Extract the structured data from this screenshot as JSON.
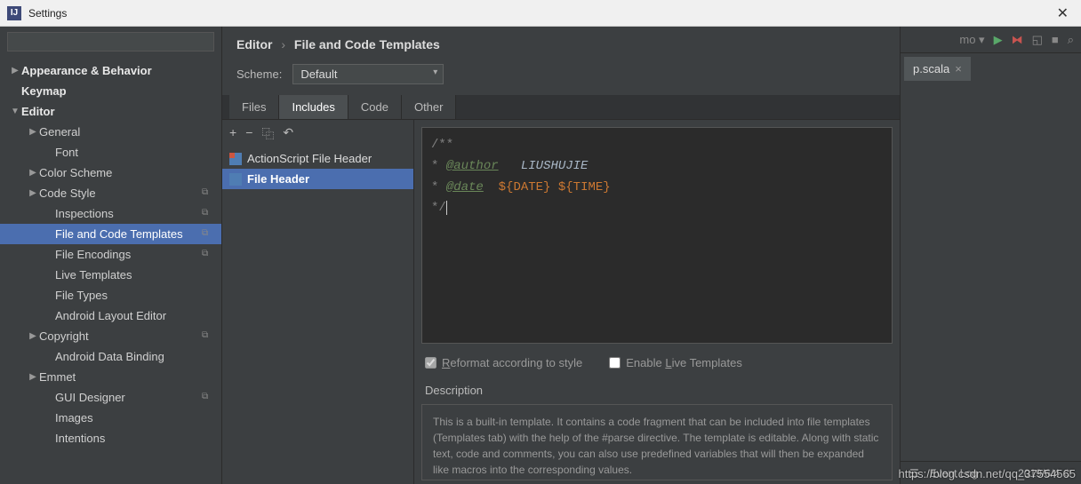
{
  "window": {
    "title": "Settings"
  },
  "search": {
    "placeholder": ""
  },
  "tree": [
    {
      "label": "Appearance & Behavior",
      "indent": 0,
      "caret": "▶",
      "bold": true
    },
    {
      "label": "Keymap",
      "indent": 0,
      "caret": "",
      "bold": true
    },
    {
      "label": "Editor",
      "indent": 0,
      "caret": "▼",
      "bold": true
    },
    {
      "label": "General",
      "indent": 1,
      "caret": "▶"
    },
    {
      "label": "Font",
      "indent": 2,
      "caret": ""
    },
    {
      "label": "Color Scheme",
      "indent": 1,
      "caret": "▶"
    },
    {
      "label": "Code Style",
      "indent": 1,
      "caret": "▶",
      "badge": "⧉"
    },
    {
      "label": "Inspections",
      "indent": 2,
      "caret": "",
      "badge": "⧉"
    },
    {
      "label": "File and Code Templates",
      "indent": 2,
      "caret": "",
      "badge": "⧉",
      "selected": true
    },
    {
      "label": "File Encodings",
      "indent": 2,
      "caret": "",
      "badge": "⧉"
    },
    {
      "label": "Live Templates",
      "indent": 2,
      "caret": ""
    },
    {
      "label": "File Types",
      "indent": 2,
      "caret": ""
    },
    {
      "label": "Android Layout Editor",
      "indent": 2,
      "caret": ""
    },
    {
      "label": "Copyright",
      "indent": 1,
      "caret": "▶",
      "badge": "⧉"
    },
    {
      "label": "Android Data Binding",
      "indent": 2,
      "caret": ""
    },
    {
      "label": "Emmet",
      "indent": 1,
      "caret": "▶"
    },
    {
      "label": "GUI Designer",
      "indent": 2,
      "caret": "",
      "badge": "⧉"
    },
    {
      "label": "Images",
      "indent": 2,
      "caret": ""
    },
    {
      "label": "Intentions",
      "indent": 2,
      "caret": ""
    }
  ],
  "breadcrumb": {
    "a": "Editor",
    "b": "File and Code Templates"
  },
  "scheme": {
    "label": "Scheme:",
    "value": "Default"
  },
  "tabs": [
    "Files",
    "Includes",
    "Code",
    "Other"
  ],
  "active_tab": 1,
  "toolbar": {
    "add": "+",
    "remove": "−",
    "copy": "⿻",
    "revert": "↶"
  },
  "templates": [
    {
      "name": "ActionScript File Header",
      "selected": false,
      "icon": "as"
    },
    {
      "name": "File Header",
      "selected": true,
      "icon": "fh"
    }
  ],
  "editor": {
    "line1_open": "/**",
    "line2_star": "* ",
    "line2_tag": "@author",
    "line2_spaces": "   ",
    "line2_ident": "LIUSHUJIE",
    "line3_star": "* ",
    "line3_tag": "@date",
    "line3_sp": "  ",
    "line3_var1": "${DATE}",
    "line3_sp2": " ",
    "line3_var2": "${TIME}",
    "line4_close": "*/"
  },
  "checks": {
    "reformat_pre": "R",
    "reformat": "eformat according to style",
    "live_pre": "Enable ",
    "live_u": "L",
    "live_post": "ive Templates"
  },
  "description": {
    "label": "Description",
    "text": "This is a built-in template. It contains a code fragment that can be included into file templates (Templates tab) with the help of the #parse directive.\nThe template is editable. Along with static text, code and comments, you can also use predefined variables that will then be expanded like macros into the corresponding values."
  },
  "right": {
    "combo_suffix": "mo ▾",
    "file_tab": "p.scala",
    "event_log": "Event Log",
    "date": "2019/6/4"
  },
  "watermark": "https://blog.csdn.net/qq_37554565"
}
